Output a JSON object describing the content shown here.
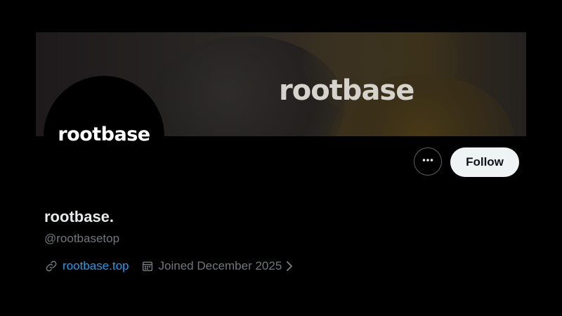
{
  "banner": {
    "text": "rootbase"
  },
  "avatar": {
    "text": "rootbase"
  },
  "actions": {
    "more_icon": "ellipsis-icon",
    "follow_label": "Follow"
  },
  "profile": {
    "display_name": "rootbase.",
    "handle": "@rootbasetop",
    "website": "rootbase.top",
    "website_icon": "link-icon",
    "joined": "Joined December 2025",
    "joined_icon": "calendar-icon",
    "joined_chevron_icon": "chevron-right-icon"
  },
  "colors": {
    "background": "#000000",
    "link": "#1d9bf0",
    "secondary_text": "#71767b",
    "primary_text": "#e7e9ea",
    "follow_button_bg": "#eff3f4"
  }
}
